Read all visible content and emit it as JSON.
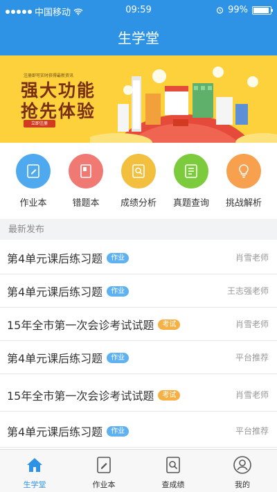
{
  "status_bar": {
    "carrier": "中国移动",
    "time": "09:59",
    "battery": "99%"
  },
  "header": {
    "title": "生学堂"
  },
  "banner": {
    "note": "注册即可实时获得最新资讯",
    "line1": "强大功能",
    "line2": "抢先体验",
    "button": "立即注册"
  },
  "quick_menu": [
    {
      "label": "作业本",
      "color": "#4fa9ee",
      "icon": "pencil-icon"
    },
    {
      "label": "错题本",
      "color": "#f07a73",
      "icon": "book-icon"
    },
    {
      "label": "成绩分析",
      "color": "#f2c03e",
      "icon": "magnifier-icon"
    },
    {
      "label": "真题查询",
      "color": "#7ccb3c",
      "icon": "document-icon"
    },
    {
      "label": "挑战解析",
      "color": "#f7a04e",
      "icon": "bulb-icon"
    }
  ],
  "section": {
    "title": "最新发布"
  },
  "list": [
    {
      "title": "第4单元课后练习题",
      "tag": "作业",
      "tag_color": "#5fb1ef",
      "author": "肖雪老师"
    },
    {
      "title": "第4单元课后练习题",
      "tag": "作业",
      "tag_color": "#5fb1ef",
      "author": "王志强老师"
    },
    {
      "title": "15年全市第一次会诊考试试题",
      "tag": "考试",
      "tag_color": "#f6b146",
      "author": "肖雪老师"
    },
    {
      "title": "第4单元课后练习题",
      "tag": "作业",
      "tag_color": "#5fb1ef",
      "author": "平台推荐"
    },
    {
      "title": "15年全市第一次会诊考试试题",
      "tag": "考试",
      "tag_color": "#f6b146",
      "author": "肖雪老师"
    },
    {
      "title": "第4单元课后练习题",
      "tag": "作业",
      "tag_color": "#5fb1ef",
      "author": "平台推荐"
    }
  ],
  "tab_bar": [
    {
      "label": "生学堂",
      "icon": "home-icon",
      "active": true
    },
    {
      "label": "作业本",
      "icon": "pencil-icon",
      "active": false
    },
    {
      "label": "查成绩",
      "icon": "magnifier-icon",
      "active": false
    },
    {
      "label": "我的",
      "icon": "user-icon",
      "active": false
    }
  ],
  "colors": {
    "primary": "#2f93e5",
    "banner_bg": "#fcd13b",
    "headline": "#7a2f12"
  }
}
